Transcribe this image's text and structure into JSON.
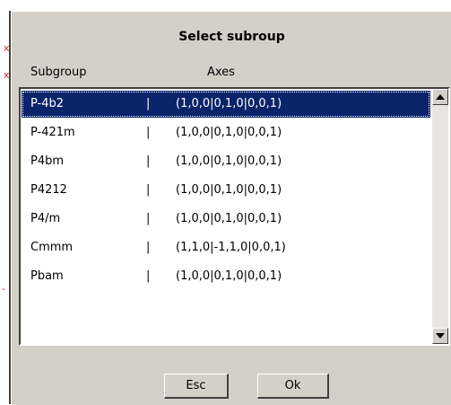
{
  "dialog": {
    "title": "Select subroup",
    "headers": {
      "subgroup": "Subgroup",
      "axes": "Axes"
    },
    "selected_index": 0,
    "rows": [
      {
        "name": "P-4b2",
        "sep": "|",
        "axes": "(1,0,0|0,1,0|0,0,1)"
      },
      {
        "name": "P-421m",
        "sep": "|",
        "axes": "(1,0,0|0,1,0|0,0,1)"
      },
      {
        "name": "P4bm",
        "sep": "|",
        "axes": "(1,0,0|0,1,0|0,0,1)"
      },
      {
        "name": "P4212",
        "sep": "|",
        "axes": "(1,0,0|0,1,0|0,0,1)"
      },
      {
        "name": "P4/m",
        "sep": "|",
        "axes": "(1,0,0|0,1,0|0,0,1)"
      },
      {
        "name": "Cmmm",
        "sep": "|",
        "axes": "(1,1,0|-1,1,0|0,0,1)"
      },
      {
        "name": "Pbam",
        "sep": "|",
        "axes": "(1,0,0|0,1,0|0,0,1)"
      }
    ],
    "buttons": {
      "esc": "Esc",
      "ok": "Ok"
    },
    "icons": {
      "scroll_up": "scroll-up-arrow-icon",
      "scroll_down": "scroll-down-arrow-icon"
    },
    "colors": {
      "selection": "#0a246a",
      "face": "#d4d0c8"
    }
  }
}
